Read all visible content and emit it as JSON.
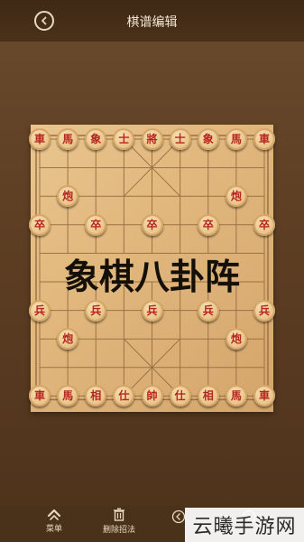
{
  "header": {
    "title": "棋谱编辑"
  },
  "overlay": {
    "text": "象棋八卦阵"
  },
  "toolbar": {
    "menu_label": "菜单",
    "delete_label": "删除招法"
  },
  "watermark": {
    "text": "云曦手游网"
  },
  "colors": {
    "red_piece": "#b5261c",
    "black_piece": "#1e120a",
    "board": "#e2b97f"
  },
  "pieces": [
    {
      "col": 0,
      "row": 0,
      "label": "車",
      "side": "red"
    },
    {
      "col": 1,
      "row": 0,
      "label": "馬",
      "side": "red"
    },
    {
      "col": 2,
      "row": 0,
      "label": "象",
      "side": "red"
    },
    {
      "col": 3,
      "row": 0,
      "label": "士",
      "side": "red"
    },
    {
      "col": 4,
      "row": 0,
      "label": "將",
      "side": "red"
    },
    {
      "col": 5,
      "row": 0,
      "label": "士",
      "side": "red"
    },
    {
      "col": 6,
      "row": 0,
      "label": "象",
      "side": "red"
    },
    {
      "col": 7,
      "row": 0,
      "label": "馬",
      "side": "red"
    },
    {
      "col": 8,
      "row": 0,
      "label": "車",
      "side": "red"
    },
    {
      "col": 1,
      "row": 2,
      "label": "炮",
      "side": "red"
    },
    {
      "col": 7,
      "row": 2,
      "label": "炮",
      "side": "red"
    },
    {
      "col": 0,
      "row": 3,
      "label": "卒",
      "side": "red"
    },
    {
      "col": 2,
      "row": 3,
      "label": "卒",
      "side": "red"
    },
    {
      "col": 4,
      "row": 3,
      "label": "卒",
      "side": "red"
    },
    {
      "col": 6,
      "row": 3,
      "label": "卒",
      "side": "red"
    },
    {
      "col": 8,
      "row": 3,
      "label": "卒",
      "side": "red"
    },
    {
      "col": 0,
      "row": 6,
      "label": "兵",
      "side": "red"
    },
    {
      "col": 2,
      "row": 6,
      "label": "兵",
      "side": "red"
    },
    {
      "col": 4,
      "row": 6,
      "label": "兵",
      "side": "red"
    },
    {
      "col": 6,
      "row": 6,
      "label": "兵",
      "side": "red"
    },
    {
      "col": 8,
      "row": 6,
      "label": "兵",
      "side": "red"
    },
    {
      "col": 1,
      "row": 7,
      "label": "炮",
      "side": "red"
    },
    {
      "col": 7,
      "row": 7,
      "label": "炮",
      "side": "red"
    },
    {
      "col": 0,
      "row": 9,
      "label": "車",
      "side": "red"
    },
    {
      "col": 1,
      "row": 9,
      "label": "馬",
      "side": "red"
    },
    {
      "col": 2,
      "row": 9,
      "label": "相",
      "side": "red"
    },
    {
      "col": 3,
      "row": 9,
      "label": "仕",
      "side": "red"
    },
    {
      "col": 4,
      "row": 9,
      "label": "帥",
      "side": "red"
    },
    {
      "col": 5,
      "row": 9,
      "label": "仕",
      "side": "red"
    },
    {
      "col": 6,
      "row": 9,
      "label": "相",
      "side": "red"
    },
    {
      "col": 7,
      "row": 9,
      "label": "馬",
      "side": "red"
    },
    {
      "col": 8,
      "row": 9,
      "label": "車",
      "side": "red"
    }
  ]
}
